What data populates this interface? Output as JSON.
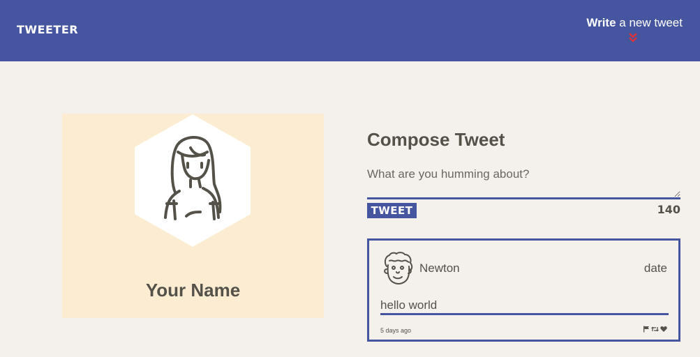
{
  "nav": {
    "brand": "TWEETER",
    "compose_strong": "Write",
    "compose_rest": " a new tweet",
    "compose_icon": "double-chevron-down-icon",
    "accent_color": "#e8312f"
  },
  "colors": {
    "primary": "#4555a0",
    "background": "#f4f1ec",
    "profile_bg": "#fcedd2",
    "text": "#545149"
  },
  "profile": {
    "name": "Your Name",
    "avatar_icon": "girl-avatar-icon"
  },
  "compose": {
    "title": "Compose Tweet",
    "placeholder": "What are you humming about?",
    "button_label": "TWEET",
    "counter": "140"
  },
  "tweet": {
    "avatar_icon": "curly-hair-avatar-icon",
    "author": "Newton",
    "date": "date",
    "body": "hello world",
    "age": "5 days ago",
    "actions": [
      "flag-icon",
      "retweet-icon",
      "heart-icon"
    ]
  }
}
